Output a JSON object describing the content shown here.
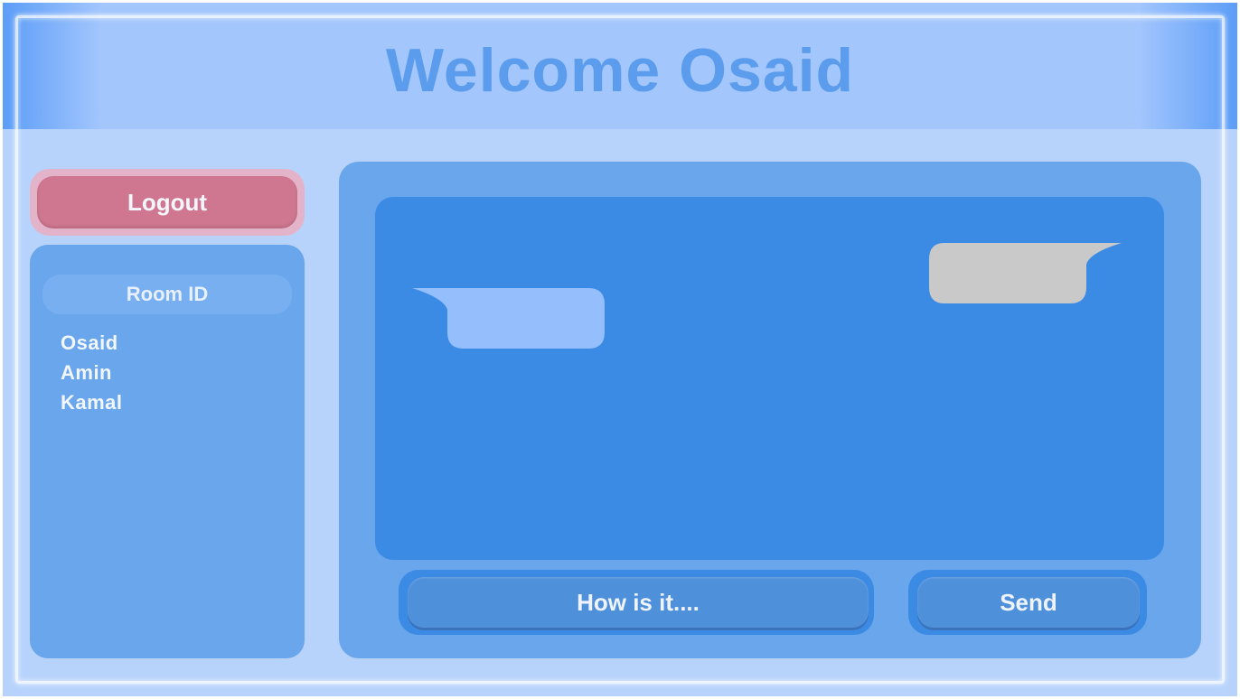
{
  "header": {
    "title": "Welcome Osaid"
  },
  "sidebar": {
    "logout_label": "Logout",
    "room_label": "Room ID",
    "users": [
      "Osaid",
      "Amin",
      "Kamal"
    ]
  },
  "chat": {
    "incoming_bubble_color": "#95bffc",
    "outgoing_bubble_color": "#c9c9c9"
  },
  "composer": {
    "input_placeholder": "How is it....",
    "send_label": "Send"
  },
  "colors": {
    "background": "#b7d3fc",
    "header": "#a3c6fd",
    "panel": "#6aa6ec",
    "chat_area": "#3b8be5",
    "logout": "#cf7790"
  }
}
